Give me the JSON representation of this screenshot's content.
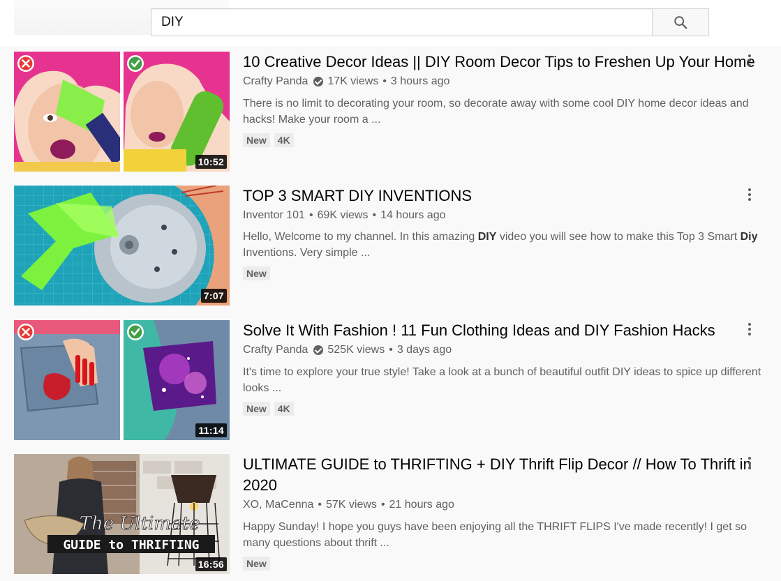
{
  "search": {
    "query": "DIY",
    "button_icon": "search-icon"
  },
  "results": [
    {
      "title": "10 Creative Decor Ideas || DIY Room Decor Tips to Freshen Up Your Home",
      "channel": "Crafty Panda",
      "verified": true,
      "views": "17K views",
      "age": "3 hours ago",
      "description": "There is no limit to decorating your room, so decorate away with some cool DIY home decor ideas and hacks! Make your room a ...",
      "badges": [
        "New",
        "4K"
      ],
      "duration": "10:52"
    },
    {
      "title": "TOP 3 SMART DIY INVENTIONS",
      "channel": "Inventor 101",
      "verified": false,
      "views": "69K views",
      "age": "14 hours ago",
      "description_parts": [
        "Hello, Welcome to my channel. In this amazing ",
        "DIY",
        " video you will see how to make this Top 3 Smart ",
        "Diy",
        " Inventions. Very simple ..."
      ],
      "badges": [
        "New"
      ],
      "duration": "7:07"
    },
    {
      "title": "Solve It With Fashion ! 11 Fun Clothing Ideas and DIY Fashion Hacks",
      "channel": "Crafty Panda",
      "verified": true,
      "views": "525K views",
      "age": "3 days ago",
      "description": "It's time to explore your true style! Take a look at a bunch of beautiful outfit DIY ideas to spice up different looks ...",
      "badges": [
        "New",
        "4K"
      ],
      "duration": "11:14"
    },
    {
      "title": "ULTIMATE GUIDE to THRIFTING + DIY Thrift Flip Decor // How To Thrift in 2020",
      "channel": "XO, MaCenna",
      "verified": false,
      "views": "57K views",
      "age": "21 hours ago",
      "description": "Happy Sunday! I hope you guys have been enjoying all the THRIFT FLIPS I've made recently! I get so many questions about thrift ...",
      "badges": [
        "New"
      ],
      "duration": "16:56",
      "thumb_overlay": {
        "script": "The Ultimate",
        "banner": "GUIDE to THRIFTING"
      }
    }
  ],
  "separator": "•",
  "colors": {
    "page_bg": "#f9f9f9",
    "text_primary": "#030303",
    "text_secondary": "#606060",
    "badge_bg": "#ececec",
    "pink_hair": "#e6338f",
    "slime_green": "#7df23e",
    "cutting_mat": "#1fa3b8",
    "x_red": "#e53935",
    "check_green": "#43a047"
  }
}
